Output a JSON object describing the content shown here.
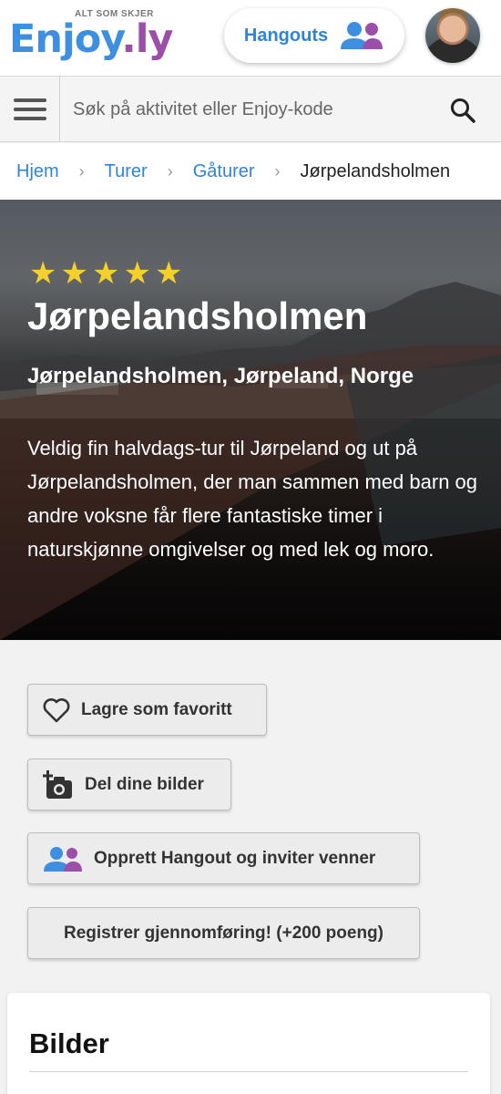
{
  "header": {
    "logo_tagline": "ALT SOM SKJER",
    "logo_part1": "Enjoy",
    "logo_part2": ".ly",
    "hangouts_label": "Hangouts",
    "colors": {
      "brand_blue": "#3f8fe0",
      "brand_purple": "#9b4fa8"
    }
  },
  "search": {
    "placeholder": "Søk på aktivitet eller Enjoy-kode",
    "value": ""
  },
  "breadcrumb": {
    "items": [
      "Hjem",
      "Turer",
      "Gåturer"
    ],
    "separator": "›",
    "current": "Jørpelandsholmen"
  },
  "hero": {
    "rating": 5,
    "star_glyph": "★",
    "title": "Jørpelandsholmen",
    "location": "Jørpelandsholmen, Jørpeland, Norge",
    "description": "Veldig fin halvdags-tur til Jørpeland og ut på Jørpelandsholmen, der man sammen med barn og andre voksne får flere fantastiske timer i naturskjønne omgivelser og med lek og moro."
  },
  "actions": {
    "favorite_label": "Lagre som favoritt",
    "share_photos_label": "Del dine bilder",
    "create_hangout_label": "Opprett Hangout og inviter venner",
    "register_label": "Registrer gjennomføring! (+200 poeng)"
  },
  "images_section": {
    "title": "Bilder"
  }
}
